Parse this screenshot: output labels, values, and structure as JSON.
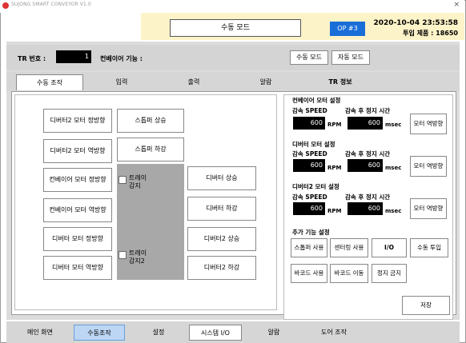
{
  "window": {
    "title": "SUJONG SMART CONVEYOR V1.0",
    "close_symbol": "×"
  },
  "header": {
    "mode": "수동 모드",
    "op": "OP #3",
    "datetime": "2020-10-04 23:53:58",
    "input_qty": "투입 제품 : 18650",
    "accent_yellow": "#fdf3c8",
    "op_color": "#1a6ed8"
  },
  "info": {
    "tr_label": "TR 번호 :",
    "tr_value": "1",
    "conveyor_label": "컨베이어 기능 :",
    "manual_mode_btn": "수동 모드",
    "auto_mode_btn": "자동 모드"
  },
  "tabs": [
    "수동 조작",
    "입력",
    "출력",
    "알람",
    "TR 정보"
  ],
  "left": {
    "col1": [
      "디버터2 모터 정방향",
      "디버터2 모터 역방향",
      "컨베이어 모터 정방향",
      "컨베이어 모터 역방향",
      "디버터 모터 정방향",
      "디버터 모터 역방향"
    ],
    "col2": [
      "스톱퍼 상승",
      "스톱퍼 하강"
    ],
    "tray_sensor": "트레이\n감지",
    "tray_sensor2": "트레이\n감지2",
    "col3": [
      "디버터 상승",
      "디버터 하강",
      "디버터2 상승",
      "디버터2 하강"
    ]
  },
  "right": {
    "conveyor_motor": {
      "title": "컨베이어 모터 설정",
      "speed_label": "감속 SPEED",
      "stop_label": "감속 후 정지 시간",
      "speed": "600",
      "speed_unit": "RPM",
      "stop": "600",
      "stop_unit": "msec",
      "reverse_btn": "모터 역방향"
    },
    "diverter_motor": {
      "title": "디버터 모터 설정",
      "speed_label": "감속 SPEED",
      "stop_label": "감속 후 정지 시간",
      "speed": "600",
      "speed_unit": "RPM",
      "stop": "600",
      "stop_unit": "msec",
      "reverse_btn": "모터 역방향"
    },
    "diverter2_motor": {
      "title": "디버터2 모터 설정",
      "speed_label": "감속 SPEED",
      "stop_label": "감속 후 정지 시간",
      "speed": "600",
      "speed_unit": "RPM",
      "stop": "600",
      "stop_unit": "msec",
      "reverse_btn": "모터 역방향"
    },
    "extra": {
      "title": "추가 기능 설정",
      "buttons_row1": [
        "스톱퍼 사용",
        "센터링 사용",
        "I/O",
        "수동 투입"
      ],
      "buttons_row2": [
        "바코드 사용",
        "바코드 이동",
        "정지 금지"
      ],
      "save": "저장"
    }
  },
  "bottom_tabs": [
    "메인 화면",
    "수동조작",
    "설정",
    "시스템 I/O",
    "알람",
    "도어 조작"
  ]
}
